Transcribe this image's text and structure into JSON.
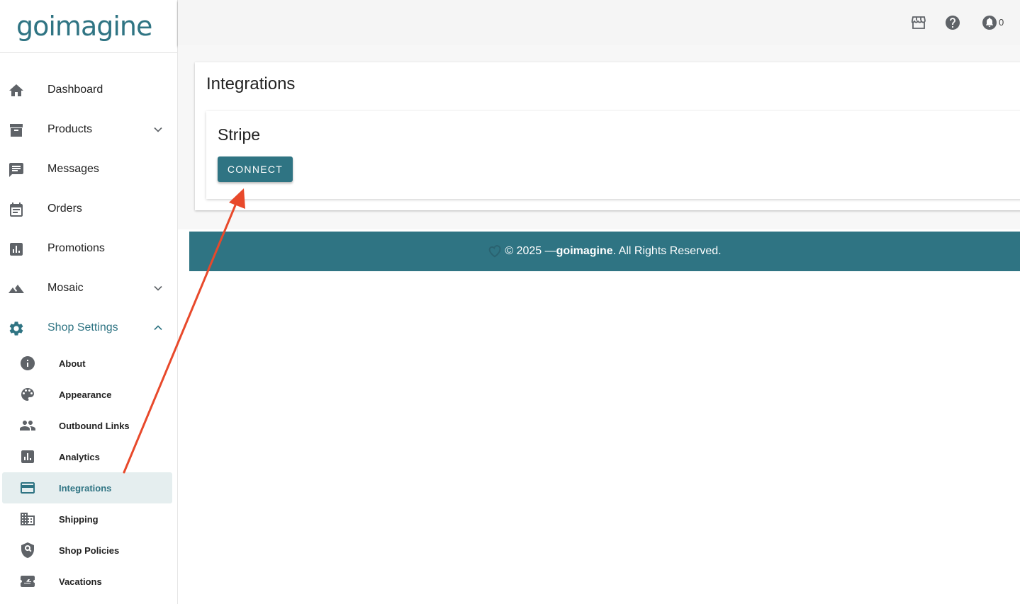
{
  "brand": {
    "logo_text": "goimagine"
  },
  "sidebar": {
    "items": [
      {
        "label": "Dashboard",
        "icon": "home-icon"
      },
      {
        "label": "Products",
        "icon": "archive-icon",
        "has_chevron": true
      },
      {
        "label": "Messages",
        "icon": "message-icon"
      },
      {
        "label": "Orders",
        "icon": "calendar-icon"
      },
      {
        "label": "Promotions",
        "icon": "bar-chart-icon"
      },
      {
        "label": "Mosaic",
        "icon": "mountain-icon",
        "has_chevron": true
      },
      {
        "label": "Shop Settings",
        "icon": "gear-icon",
        "expanded": true
      }
    ],
    "sub_items": [
      {
        "label": "About",
        "icon": "info-icon"
      },
      {
        "label": "Appearance",
        "icon": "palette-icon"
      },
      {
        "label": "Outbound Links",
        "icon": "people-icon"
      },
      {
        "label": "Analytics",
        "icon": "analytics-icon"
      },
      {
        "label": "Integrations",
        "icon": "credit-card-icon",
        "selected": true
      },
      {
        "label": "Shipping",
        "icon": "building-icon"
      },
      {
        "label": "Shop Policies",
        "icon": "shield-search-icon"
      },
      {
        "label": "Vacations",
        "icon": "plane-ticket-icon"
      }
    ]
  },
  "topbar": {
    "icons": [
      "storefront-icon",
      "help-icon",
      "notification-icon"
    ],
    "notification_count": "0"
  },
  "main": {
    "title": "Integrations",
    "integration": {
      "name": "Stripe",
      "button_label": "CONNECT"
    }
  },
  "footer": {
    "prefix": "© 2025 — ",
    "brand": "goimagine",
    "suffix": ". All Rights Reserved."
  },
  "colors": {
    "accent": "#2f7483",
    "selected_bg": "#e5eeef",
    "annotation_arrow": "#e8492b",
    "icon_gray": "#5f6368"
  }
}
